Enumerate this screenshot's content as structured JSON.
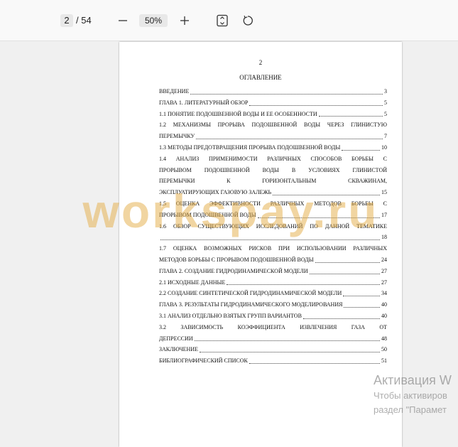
{
  "toolbar": {
    "current_page": "2",
    "total_pages": "/ 54",
    "zoom": "50%",
    "icons": {
      "zoom_out": "minus-icon",
      "zoom_in": "plus-icon",
      "fit": "fit-page-icon",
      "rotate": "rotate-icon"
    }
  },
  "document": {
    "page_number": "2",
    "toc_title": "ОГЛАВЛЕНИЕ",
    "toc": [
      {
        "text": "ВВЕДЕНИЕ",
        "page": "3"
      },
      {
        "text": "ГЛАВА 1. ЛИТЕРАТУРНЫЙ ОБЗОР",
        "page": "5"
      },
      {
        "text": "1.1 ПОНЯТИЕ ПОДОШВЕННОЙ ВОДЫ И ЕЕ ОСОБЕННОСТИ",
        "page": "5"
      },
      {
        "text": "1.2 МЕХАНИЗМЫ ПРОРЫВА ПОДОШВЕННОЙ ВОДЫ ЧЕРЕЗ ГЛИНИСТУЮ",
        "page": ""
      },
      {
        "text": "ПЕРЕМЫЧКУ",
        "page": "7"
      },
      {
        "text": "1.3 МЕТОДЫ ПРЕДОТВРАЩЕНИЯ ПРОРЫВА ПОДОШВЕННОЙ ВОДЫ",
        "page": "10"
      },
      {
        "text": "1.4 АНАЛИЗ ПРИМЕНИМОСТИ РАЗЛИЧНЫХ СПОСОБОВ БОРЬБЫ С",
        "page": ""
      },
      {
        "text": "ПРОРЫВОМ ПОДОШВЕННОЙ ВОДЫ В УСЛОВИЯХ ГЛИНИСТОЙ",
        "page": ""
      },
      {
        "text": "ПЕРЕМЫЧКИ К ГОРИЗОНТАЛЬНЫМ СКВАЖИНАМ,",
        "page": ""
      },
      {
        "text": "ЭКСПЛУАТИРУЮЩИХ ГАЗОВУЮ ЗАЛЕЖЬ",
        "page": "15"
      },
      {
        "text": "1.5 ОЦЕНКА ЭФФЕКТИВНОСТИ РАЗЛИЧНЫХ МЕТОДОВ БОРЬБЫ С",
        "page": ""
      },
      {
        "text": "ПРОРЫВОМ ПОДОШВЕННОЙ ВОДЫ",
        "page": "17"
      },
      {
        "text": "1.6 ОБЗОР СУЩЕСТВУЮЩИХ ИССЛЕДОВАНИЙ ПО ДАННОЙ ТЕМАТИКЕ",
        "page": ""
      },
      {
        "text": "",
        "page": "18"
      },
      {
        "text": "1.7 ОЦЕНКА ВОЗМОЖНЫХ РИСКОВ ПРИ ИСПОЛЬЗОВАНИИ РАЗЛИЧНЫХ",
        "page": ""
      },
      {
        "text": "МЕТОДОВ БОРЬБЫ С ПРОРЫВОМ ПОДОШВЕННОЙ ВОДЫ",
        "page": "24"
      },
      {
        "text": "ГЛАВА 2. СОЗДАНИЕ ГИДРОДИНАМИЧЕСКОЙ МОДЕЛИ",
        "page": "27"
      },
      {
        "text": "2.1 ИСХОДНЫЕ ДАННЫЕ",
        "page": "27"
      },
      {
        "text": "2.2 СОЗДАНИЕ СИНТЕТИЧЕСКОЙ ГИДРОДИНАМИЧЕСКОЙ МОДЕЛИ",
        "page": "34"
      },
      {
        "text": "ГЛАВА 3. РЕЗУЛЬТАТЫ ГИДРОДИНАМИЧЕСКОГО МОДЕЛИРОВАНИЯ",
        "page": "40"
      },
      {
        "text": "3.1 АНАЛИЗ ОТДЕЛЬНО ВЗЯТЫХ ГРУПП ВАРИАНТОВ",
        "page": "40"
      },
      {
        "text": "3.2 ЗАВИСИМОСТЬ КОЭФФИЦИЕНТА ИЗВЛЕЧЕНИЯ ГАЗА ОТ",
        "page": ""
      },
      {
        "text": "ДЕПРЕССИИ",
        "page": "48"
      },
      {
        "text": "ЗАКЛЮЧЕНИЕ",
        "page": "50"
      },
      {
        "text": "БИБЛИОГРАФИЧЕСКИЙ СПИСОК",
        "page": "51"
      }
    ],
    "watermark": "workspay.ru"
  },
  "activation": {
    "title": "Активация W",
    "line1": "Чтобы активиров",
    "line2": "раздел \"Парамет"
  },
  "colors": {
    "toolbar_bg": "#f9f9f9",
    "viewer_bg": "#f0f0f0",
    "watermark": "#e4ac44"
  }
}
